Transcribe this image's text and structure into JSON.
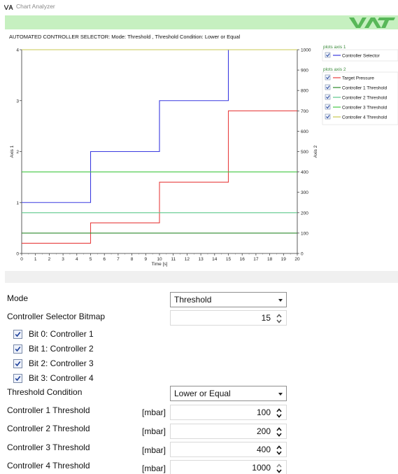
{
  "window": {
    "title": "Chart Analyzer"
  },
  "brand": {
    "logo_text": "VAT",
    "bar_color": "#c6f0c0",
    "logo_color": "#58b858"
  },
  "chart_data": {
    "type": "line",
    "title": "AUTOMATED CONTROLLER SELECTOR:  Mode: Threshold  ,  Threshold Condition: Lower or Equal",
    "xlabel": "Time [s]",
    "ylabel_left": "Axis 1",
    "ylabel_right": "Axis 2",
    "xlim": [
      0,
      20
    ],
    "ylim_left": [
      0,
      4
    ],
    "ylim_right": [
      0,
      1000
    ],
    "x_ticks": [
      "0",
      "1",
      "2",
      "3",
      "4",
      "5",
      "6",
      "7",
      "8",
      "9",
      "10",
      "11",
      "12",
      "13",
      "14",
      "15",
      "16",
      "17",
      "18",
      "19",
      "20"
    ],
    "y_left_ticks": [
      "0",
      "1",
      "2",
      "3",
      "4"
    ],
    "y_right_ticks": [
      "0",
      "100",
      "200",
      "300",
      "400",
      "500",
      "600",
      "700",
      "800",
      "900",
      "1000"
    ],
    "legend_axis1_title": "plots axis 1",
    "legend_axis2_title": "plots axis 2",
    "series": [
      {
        "name": "Controller Selector",
        "axis": 1,
        "color": "#3a3ae0",
        "step": true,
        "x": [
          0,
          5,
          5,
          10,
          10,
          15,
          15
        ],
        "y": [
          1,
          1,
          2,
          2,
          3,
          3,
          4
        ]
      },
      {
        "name": "Target Pressure",
        "axis": 2,
        "color": "#e84040",
        "step": true,
        "x": [
          0,
          5,
          5,
          10,
          10,
          15,
          15,
          20
        ],
        "y": [
          50,
          50,
          150,
          150,
          350,
          350,
          700,
          700
        ]
      },
      {
        "name": "Controller 1 Threshold",
        "axis": 2,
        "color": "#2c8a2c",
        "x": [
          0,
          20
        ],
        "y": [
          100,
          100
        ]
      },
      {
        "name": "Controller 2 Threshold",
        "axis": 2,
        "color": "#5cc88a",
        "x": [
          0,
          20
        ],
        "y": [
          200,
          200
        ]
      },
      {
        "name": "Controller 3 Threshold",
        "axis": 2,
        "color": "#46c846",
        "x": [
          0,
          20
        ],
        "y": [
          400,
          400
        ]
      },
      {
        "name": "Controller 4 Threshold",
        "axis": 2,
        "color": "#c8c850",
        "x": [
          0,
          20
        ],
        "y": [
          1000,
          1000
        ]
      }
    ]
  },
  "form": {
    "mode_label": "Mode",
    "mode_value": "Threshold",
    "bitmap_label": "Controller Selector Bitmap",
    "bitmap_value": "15",
    "bits": [
      {
        "label": "Bit 0: Controller 1",
        "checked": true
      },
      {
        "label": "Bit 1: Controller 2",
        "checked": true
      },
      {
        "label": "Bit 2: Controller 3",
        "checked": true
      },
      {
        "label": "Bit 3: Controller 4",
        "checked": true
      }
    ],
    "condition_label": "Threshold Condition",
    "condition_value": "Lower or Equal",
    "thresholds": [
      {
        "label": "Controller 1 Threshold",
        "unit": "[mbar]",
        "value": "100"
      },
      {
        "label": "Controller 2 Threshold",
        "unit": "[mbar]",
        "value": "200"
      },
      {
        "label": "Controller 3 Threshold",
        "unit": "[mbar]",
        "value": "400"
      },
      {
        "label": "Controller 4 Threshold",
        "unit": "[mbar]",
        "value": "1000"
      }
    ]
  },
  "icons": {
    "app": "vat-app-icon",
    "checkbox": "checkmark-icon",
    "spin_up": "chevron-up-icon",
    "spin_down": "chevron-down-icon",
    "dropdown": "dropdown-arrow-icon"
  }
}
